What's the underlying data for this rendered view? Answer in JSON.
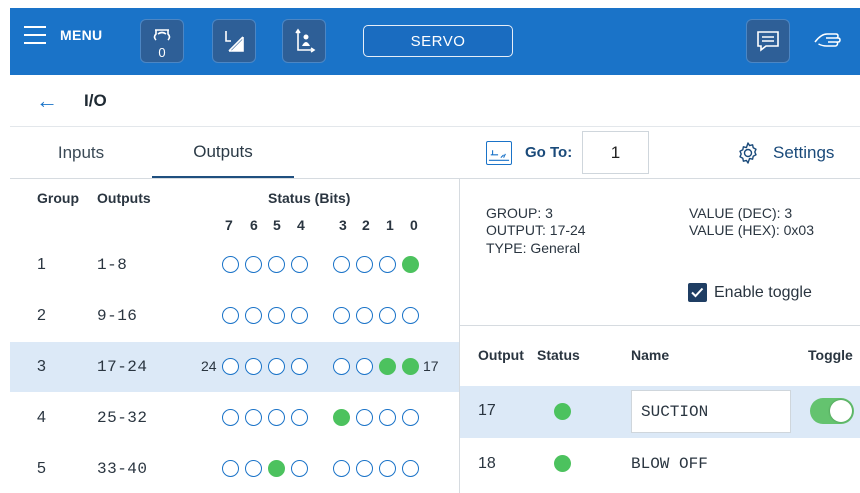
{
  "header": {
    "menu_label": "MENU",
    "counter_badge": "0",
    "servo_label": "SERVO",
    "icons": [
      "menu-icon",
      "gripper-icon",
      "angle-icon",
      "coordinate-icon",
      "chat-icon",
      "hand-icon"
    ],
    "accent_color": "#1a73c8"
  },
  "page": {
    "title": "I/O"
  },
  "tabs": [
    {
      "label": "Inputs",
      "active": false
    },
    {
      "label": "Outputs",
      "active": true
    }
  ],
  "goto": {
    "label": "Go To:",
    "value": "1",
    "settings_label": "Settings"
  },
  "table": {
    "headers": {
      "group": "Group",
      "outputs": "Outputs",
      "status": "Status (Bits)"
    },
    "bit_labels": [
      "7",
      "6",
      "5",
      "4",
      "3",
      "2",
      "1",
      "0"
    ],
    "rows": [
      {
        "group": "1",
        "outputs": "1-8",
        "bits": [
          0,
          0,
          0,
          0,
          0,
          0,
          0,
          1
        ],
        "selected": false
      },
      {
        "group": "2",
        "outputs": "9-16",
        "bits": [
          0,
          0,
          0,
          0,
          0,
          0,
          0,
          0
        ],
        "selected": false
      },
      {
        "group": "3",
        "outputs": "17-24",
        "bits": [
          0,
          0,
          0,
          0,
          0,
          0,
          1,
          1
        ],
        "selected": true,
        "left_label": "24",
        "right_label": "17"
      },
      {
        "group": "4",
        "outputs": "25-32",
        "bits": [
          0,
          0,
          0,
          0,
          1,
          0,
          0,
          0
        ],
        "selected": false
      },
      {
        "group": "5",
        "outputs": "33-40",
        "bits": [
          0,
          0,
          1,
          0,
          0,
          0,
          0,
          0
        ],
        "selected": false
      }
    ]
  },
  "details": {
    "group": "GROUP: 3",
    "output": "OUTPUT: 17-24",
    "type": "TYPE: General",
    "value_dec": "VALUE (DEC): 3",
    "value_hex": "VALUE (HEX): 0x03",
    "enable_toggle_label": "Enable toggle",
    "enable_toggle_checked": true
  },
  "output_list": {
    "headers": {
      "output": "Output",
      "status": "Status",
      "name": "Name",
      "toggle": "Toggle"
    },
    "rows": [
      {
        "output": "17",
        "status_on": true,
        "name": "SUCTION",
        "toggle_on": true
      },
      {
        "output": "18",
        "status_on": true,
        "name": "BLOW OFF"
      }
    ]
  }
}
